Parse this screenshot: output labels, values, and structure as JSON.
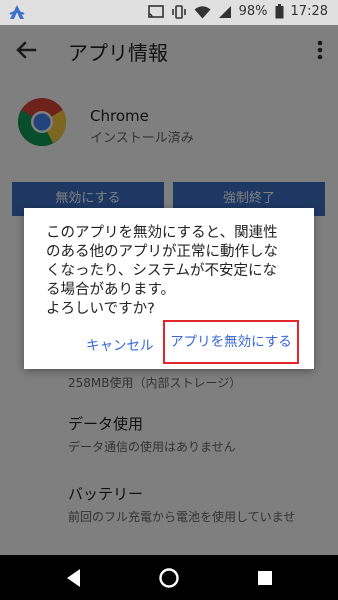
{
  "status_bar": {
    "battery_percent": "98%",
    "time": "17:28"
  },
  "app_bar": {
    "title": "アプリ情報"
  },
  "app": {
    "name": "Chrome",
    "install_status": "インストール済み"
  },
  "buttons": {
    "disable": "無効にする",
    "force_stop": "強制終了"
  },
  "list": [
    {
      "subtitle": "258MB使用（内部ストレージ）"
    },
    {
      "title": "データ使用",
      "subtitle": "データ通信の使用はありません"
    },
    {
      "title": "バッテリー",
      "subtitle": "前回のフル充電から電池を使用していませ"
    }
  ],
  "dialog": {
    "message_lines": [
      "このアプリを無効にすると、関連性",
      "のある他のアプリが正常に動作しな",
      "くなったり、システムが不安定にな",
      "る場合があります。",
      "よろしいですか?"
    ],
    "cancel_label": "キャンセル",
    "confirm_label": "アプリを無効にする"
  },
  "colors": {
    "accent": "#3367d6",
    "button_blue": "#3d70c9",
    "highlight_red": "#e3262c"
  },
  "icons": [
    "notification-a-icon",
    "cast-icon",
    "vibrate-icon",
    "wifi-icon",
    "signal-icon",
    "battery-icon",
    "back-arrow-icon",
    "more-vert-icon",
    "chrome-logo",
    "nav-back-icon",
    "nav-home-icon",
    "nav-recents-icon"
  ]
}
